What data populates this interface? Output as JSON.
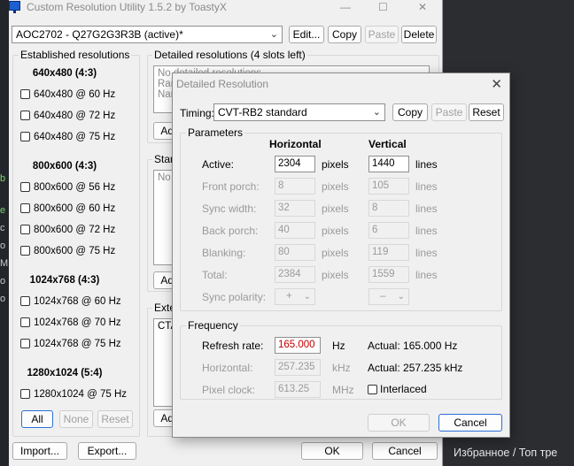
{
  "main_window": {
    "title": "Custom Resolution Utility 1.5.2 by ToastyX",
    "monitor_select": "AOC2702 - Q27G2G3R3B (active)*",
    "buttons": {
      "edit": "Edit...",
      "copy": "Copy",
      "paste": "Paste",
      "delete": "Delete"
    },
    "established": {
      "title": "Established resolutions",
      "groups": [
        {
          "heading": "640x480 (4:3)",
          "items": [
            "640x480 @ 60 Hz",
            "640x480 @ 72 Hz",
            "640x480 @ 75 Hz"
          ]
        },
        {
          "heading": "800x600 (4:3)",
          "items": [
            "800x600 @ 56 Hz",
            "800x600 @ 60 Hz",
            "800x600 @ 72 Hz",
            "800x600 @ 75 Hz"
          ]
        },
        {
          "heading": "1024x768 (4:3)",
          "items": [
            "1024x768 @ 60 Hz",
            "1024x768 @ 70 Hz",
            "1024x768 @ 75 Hz"
          ]
        },
        {
          "heading": "1280x1024 (5:4)",
          "items": [
            "1280x1024 @ 75 Hz"
          ]
        }
      ],
      "all": "All",
      "none": "None",
      "reset": "Reset"
    },
    "detailed": {
      "title": "Detailed resolutions (4 slots left)",
      "list": [
        "No detailed resolutions",
        "Ran",
        "Nam"
      ],
      "add": "Add"
    },
    "standard": {
      "title": "Stan",
      "list": [
        "No s"
      ],
      "add": "Add"
    },
    "extension": {
      "title": "Exte",
      "list": [
        "CTA"
      ],
      "add": "Add"
    },
    "import": "Import...",
    "export": "Export...",
    "ok": "OK",
    "cancel": "Cancel"
  },
  "dialog": {
    "title": "Detailed Resolution",
    "timing_label": "Timing:",
    "timing_value": "CVT-RB2 standard",
    "copy": "Copy",
    "paste": "Paste",
    "reset": "Reset",
    "parameters_title": "Parameters",
    "col_horizontal": "Horizontal",
    "col_vertical": "Vertical",
    "rows": [
      {
        "label": "Active:",
        "h": "2304",
        "h_unit": "pixels",
        "v": "1440",
        "v_unit": "lines"
      },
      {
        "label": "Front porch:",
        "h": "8",
        "h_unit": "pixels",
        "v": "105",
        "v_unit": "lines"
      },
      {
        "label": "Sync width:",
        "h": "32",
        "h_unit": "pixels",
        "v": "8",
        "v_unit": "lines"
      },
      {
        "label": "Back porch:",
        "h": "40",
        "h_unit": "pixels",
        "v": "6",
        "v_unit": "lines"
      },
      {
        "label": "Blanking:",
        "h": "80",
        "h_unit": "pixels",
        "v": "119",
        "v_unit": "lines"
      },
      {
        "label": "Total:",
        "h": "2384",
        "h_unit": "pixels",
        "v": "1559",
        "v_unit": "lines"
      }
    ],
    "sync_polarity_label": "Sync polarity:",
    "sync_h": "+",
    "sync_v": "–",
    "frequency_title": "Frequency",
    "refresh_label": "Refresh rate:",
    "refresh_value": "165.000",
    "refresh_unit": "Hz",
    "refresh_actual": "Actual: 165.000 Hz",
    "horizontal_label": "Horizontal:",
    "horizontal_value": "257.235",
    "horizontal_unit": "kHz",
    "horizontal_actual": "Actual: 257.235 kHz",
    "pixel_clock_label": "Pixel clock:",
    "pixel_clock_value": "613.25",
    "pixel_clock_unit": "MHz",
    "interlaced_label": "Interlaced",
    "ok": "OK",
    "cancel": "Cancel"
  },
  "background": {
    "bottom_text": "Избранное / Топ тре"
  },
  "colors": {
    "accent": "#2a6fd6",
    "refresh_text": "#c00000"
  }
}
